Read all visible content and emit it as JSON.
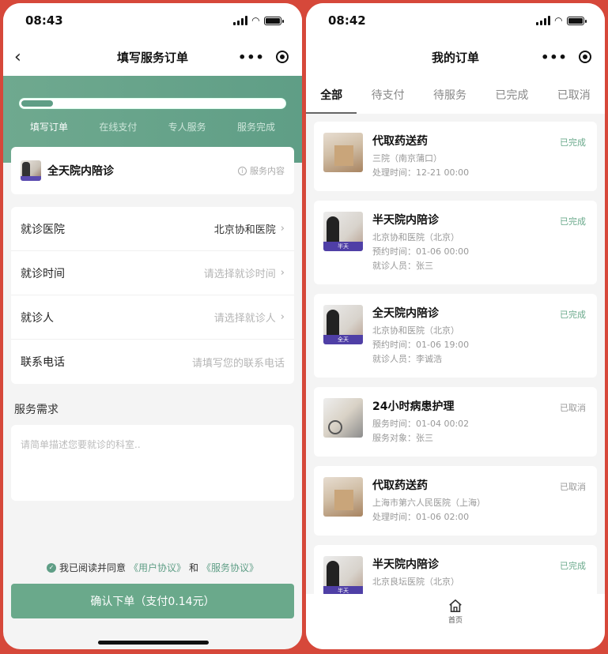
{
  "left": {
    "status_time": "08:43",
    "nav_title": "填写服务订单",
    "steps": [
      "填写订单",
      "在线支付",
      "专人服务",
      "服务完成"
    ],
    "progress": 0.12,
    "service": {
      "name": "全天院内陪诊",
      "info": "服务内容"
    },
    "form": [
      {
        "label": "就诊医院",
        "value": "北京协和医院",
        "placeholder": false
      },
      {
        "label": "就诊时间",
        "value": "请选择就诊时间",
        "placeholder": true
      },
      {
        "label": "就诊人",
        "value": "请选择就诊人",
        "placeholder": true
      },
      {
        "label": "联系电话",
        "value": "请填写您的联系电话",
        "placeholder": true
      }
    ],
    "needs_title": "服务需求",
    "needs_placeholder": "请简单描述您要就诊的科室..",
    "agree_prefix": "我已阅读并同意",
    "agree_link1": "《用户协议》",
    "agree_and": "和",
    "agree_link2": "《服务协议》",
    "submit_label": "确认下单（支付0.14元）"
  },
  "right": {
    "status_time": "08:42",
    "nav_title": "我的订单",
    "tabs": [
      "全部",
      "待支付",
      "待服务",
      "已完成",
      "已取消"
    ],
    "orders": [
      {
        "title": "代取药送药",
        "lines": [
          "三院（南京蒲口）",
          "处理时间：12-21 00:00"
        ],
        "status": "已完成",
        "img": "med"
      },
      {
        "title": "半天院内陪诊",
        "lines": [
          "北京协和医院（北京）",
          "预约时间：01-06 00:00",
          "就诊人员：张三"
        ],
        "status": "已完成",
        "img": "doc",
        "badge": "半天"
      },
      {
        "title": "全天院内陪诊",
        "lines": [
          "北京协和医院（北京）",
          "预约时间：01-06 19:00",
          "就诊人员：李诚浩"
        ],
        "status": "已完成",
        "img": "doc",
        "badge": "全天"
      },
      {
        "title": "24小时病患护理",
        "lines": [
          "服务时间：01-04 00:02",
          "服务对象：张三"
        ],
        "status": "已取消",
        "img": "care"
      },
      {
        "title": "代取药送药",
        "lines": [
          "上海市第六人民医院（上海）",
          "处理时间：01-06 02:00"
        ],
        "status": "已取消",
        "img": "med"
      },
      {
        "title": "半天院内陪诊",
        "lines": [
          "北京良坛医院（北京）"
        ],
        "status": "已完成",
        "img": "doc",
        "badge": "半天"
      }
    ],
    "bottom_nav_label": "首页"
  }
}
